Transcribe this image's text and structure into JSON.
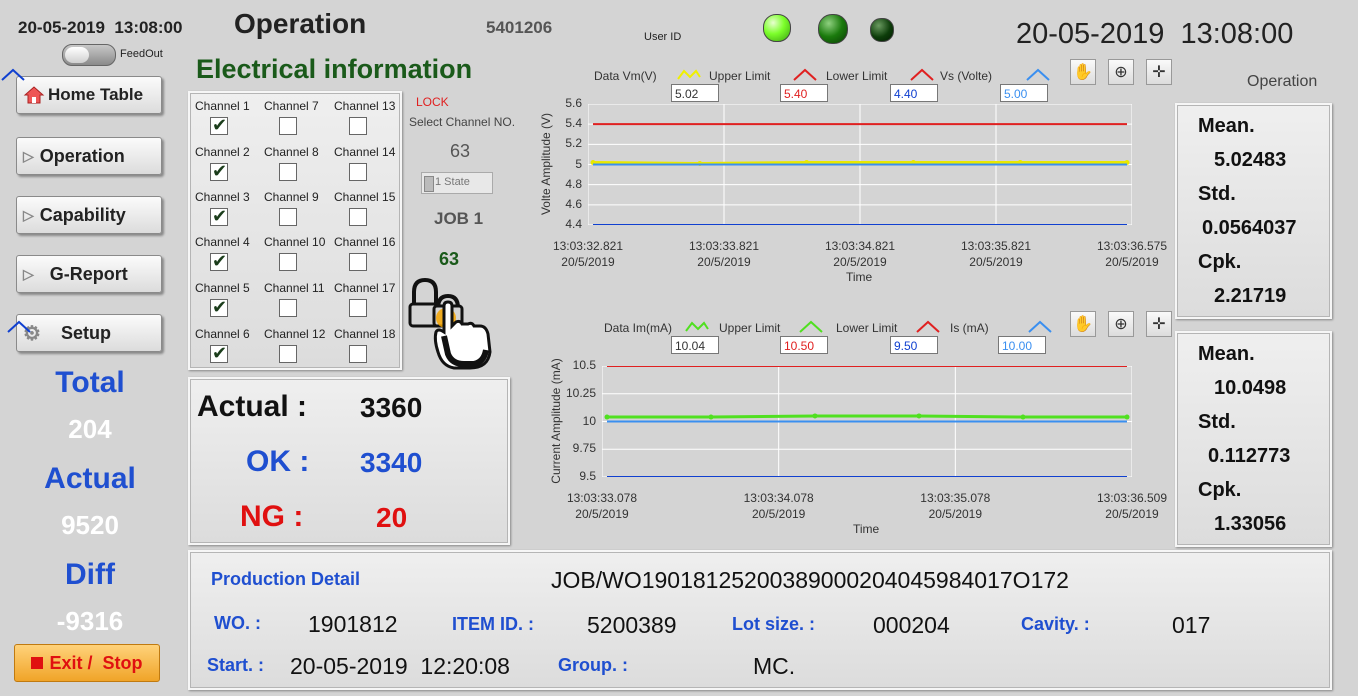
{
  "header": {
    "datetime_small": "20-05-2019  13:08:00",
    "feedout_label": "FeedOut",
    "title": "Operation",
    "code": "5401206",
    "user_id_label": "User ID",
    "datetime_big": "20-05-2019  13:08:00",
    "mode_label": "Operation",
    "lights": [
      "#7cff2a",
      "#1a7a0c",
      "#0d3d0a"
    ]
  },
  "nav": {
    "home": "Home Table",
    "operation": "Operation",
    "capability": "Capability",
    "greport": "G-Report",
    "setup": "Setup",
    "exit": "Exit /  Stop"
  },
  "summary": {
    "total_label": "Total",
    "total_value": "204",
    "actual_label": "Actual",
    "actual_value": "9520",
    "diff_label": "Diff",
    "diff_value": "-9316"
  },
  "electrical": {
    "title": "Electrical information",
    "channels": [
      {
        "label": "Channel 1",
        "checked": true
      },
      {
        "label": "Channel 2",
        "checked": true
      },
      {
        "label": "Channel 3",
        "checked": true
      },
      {
        "label": "Channel 4",
        "checked": true
      },
      {
        "label": "Channel 5",
        "checked": true
      },
      {
        "label": "Channel 6",
        "checked": true
      },
      {
        "label": "Channel 7",
        "checked": false
      },
      {
        "label": "Channel 8",
        "checked": false
      },
      {
        "label": "Channel 9",
        "checked": false
      },
      {
        "label": "Channel 10",
        "checked": false
      },
      {
        "label": "Channel 11",
        "checked": false
      },
      {
        "label": "Channel 12",
        "checked": false
      },
      {
        "label": "Channel 13",
        "checked": false
      },
      {
        "label": "Channel 14",
        "checked": false
      },
      {
        "label": "Channel 15",
        "checked": false
      },
      {
        "label": "Channel 16",
        "checked": false
      },
      {
        "label": "Channel 17",
        "checked": false
      },
      {
        "label": "Channel 18",
        "checked": false
      }
    ],
    "lock_label": "LOCK",
    "select_label": "Select Channel NO.",
    "select_value": "63",
    "state_value": "1 State",
    "job_label": "JOB 1",
    "job_value": "63"
  },
  "counts": {
    "actual_label": "Actual :",
    "actual_value": "3360",
    "ok_label": "OK :",
    "ok_value": "3340",
    "ng_label": "NG :",
    "ng_value": "20"
  },
  "chart_data": [
    {
      "type": "line",
      "ylabel": "Volte Amplitude (V)",
      "xlabel": "Time",
      "ylim": [
        4.4,
        5.6
      ],
      "yticks": [
        "5.6",
        "5.4",
        "5.2",
        "5",
        "4.8",
        "4.6",
        "4.4"
      ],
      "xticks": [
        [
          "13:03:32.821",
          "20/5/2019"
        ],
        [
          "13:03:33.821",
          "20/5/2019"
        ],
        [
          "13:03:34.821",
          "20/5/2019"
        ],
        [
          "13:03:35.821",
          "20/5/2019"
        ],
        [
          "13:03:36.575",
          "20/5/2019"
        ]
      ],
      "legend": [
        {
          "name": "Data Vm(V)",
          "color": "#f0f000",
          "value": ""
        },
        {
          "name": "Upper Limit",
          "color": "#e02020",
          "value": "5.02"
        },
        {
          "name": "Lower Limit",
          "color": "#e02020",
          "value": "5.40"
        },
        {
          "name": "Vs (Volte)",
          "color": "#1040d0",
          "value": "4.40"
        },
        {
          "name": "",
          "color": "#3a8ff0",
          "value": "5.00"
        }
      ],
      "series": [
        {
          "name": "Data Vm(V)",
          "color": "#e8e800",
          "values": [
            5.02,
            5.01,
            5.02,
            5.02,
            5.02,
            5.02
          ]
        },
        {
          "name": "Upper Limit",
          "color": "#e02020",
          "values": [
            5.4,
            5.4
          ]
        },
        {
          "name": "Vs (Volte)",
          "color": "#1040d0",
          "values": [
            4.4,
            4.4
          ]
        },
        {
          "name": "",
          "color": "#3a8ff0",
          "values": [
            5.0,
            5.0
          ]
        }
      ]
    },
    {
      "type": "line",
      "ylabel": "Current Amplitude (mA)",
      "xlabel": "Time",
      "ylim": [
        9.5,
        10.5
      ],
      "yticks": [
        "10.5",
        "10.25",
        "10",
        "9.75",
        "9.5"
      ],
      "xticks": [
        [
          "13:03:33.078",
          "20/5/2019"
        ],
        [
          "13:03:34.078",
          "20/5/2019"
        ],
        [
          "13:03:35.078",
          "20/5/2019"
        ],
        [
          "13:03:36.509",
          "20/5/2019"
        ]
      ],
      "legend": [
        {
          "name": "Data Im(mA)",
          "color": "#50e020",
          "value": ""
        },
        {
          "name": "Upper Limit",
          "color": "#50e020",
          "value": "10.04"
        },
        {
          "name": "Lower Limit",
          "color": "#e02020",
          "value": "10.50"
        },
        {
          "name": "Is (mA)",
          "color": "#1040d0",
          "value": "9.50"
        },
        {
          "name": "",
          "color": "#3a8ff0",
          "value": "10.00"
        }
      ],
      "series": [
        {
          "name": "Data Im(mA)",
          "color": "#50e020",
          "values": [
            10.04,
            10.04,
            10.05,
            10.05,
            10.04,
            10.04
          ]
        },
        {
          "name": "Upper Limit",
          "color": "#e02020",
          "values": [
            10.5,
            10.5
          ]
        },
        {
          "name": "Is (mA)",
          "color": "#1040d0",
          "values": [
            9.5,
            9.5
          ]
        },
        {
          "name": "",
          "color": "#3a8ff0",
          "values": [
            10.0,
            10.0
          ]
        }
      ]
    }
  ],
  "stats_v": {
    "mean_label": "Mean.",
    "mean": "5.02483",
    "std_label": "Std.",
    "std": "0.0564037",
    "cpk_label": "Cpk.",
    "cpk": "2.21719"
  },
  "stats_i": {
    "mean_label": "Mean.",
    "mean": "10.0498",
    "std_label": "Std.",
    "std": "0.112773",
    "cpk_label": "Cpk.",
    "cpk": "1.33056"
  },
  "production": {
    "title": "Production Detail",
    "job_wo": "JOB/WO19018125200389000204045984017O172",
    "wo_label": "WO. :",
    "wo_value": "1901812",
    "item_label": "ITEM ID. :",
    "item_value": "5200389",
    "lot_label": "Lot size. :",
    "lot_value": "000204",
    "cavity_label": "Cavity. :",
    "cavity_value": "017",
    "start_label": "Start. :",
    "start_value": "20-05-2019  12:20:08",
    "group_label": "Group. :",
    "group_value": "MC."
  }
}
